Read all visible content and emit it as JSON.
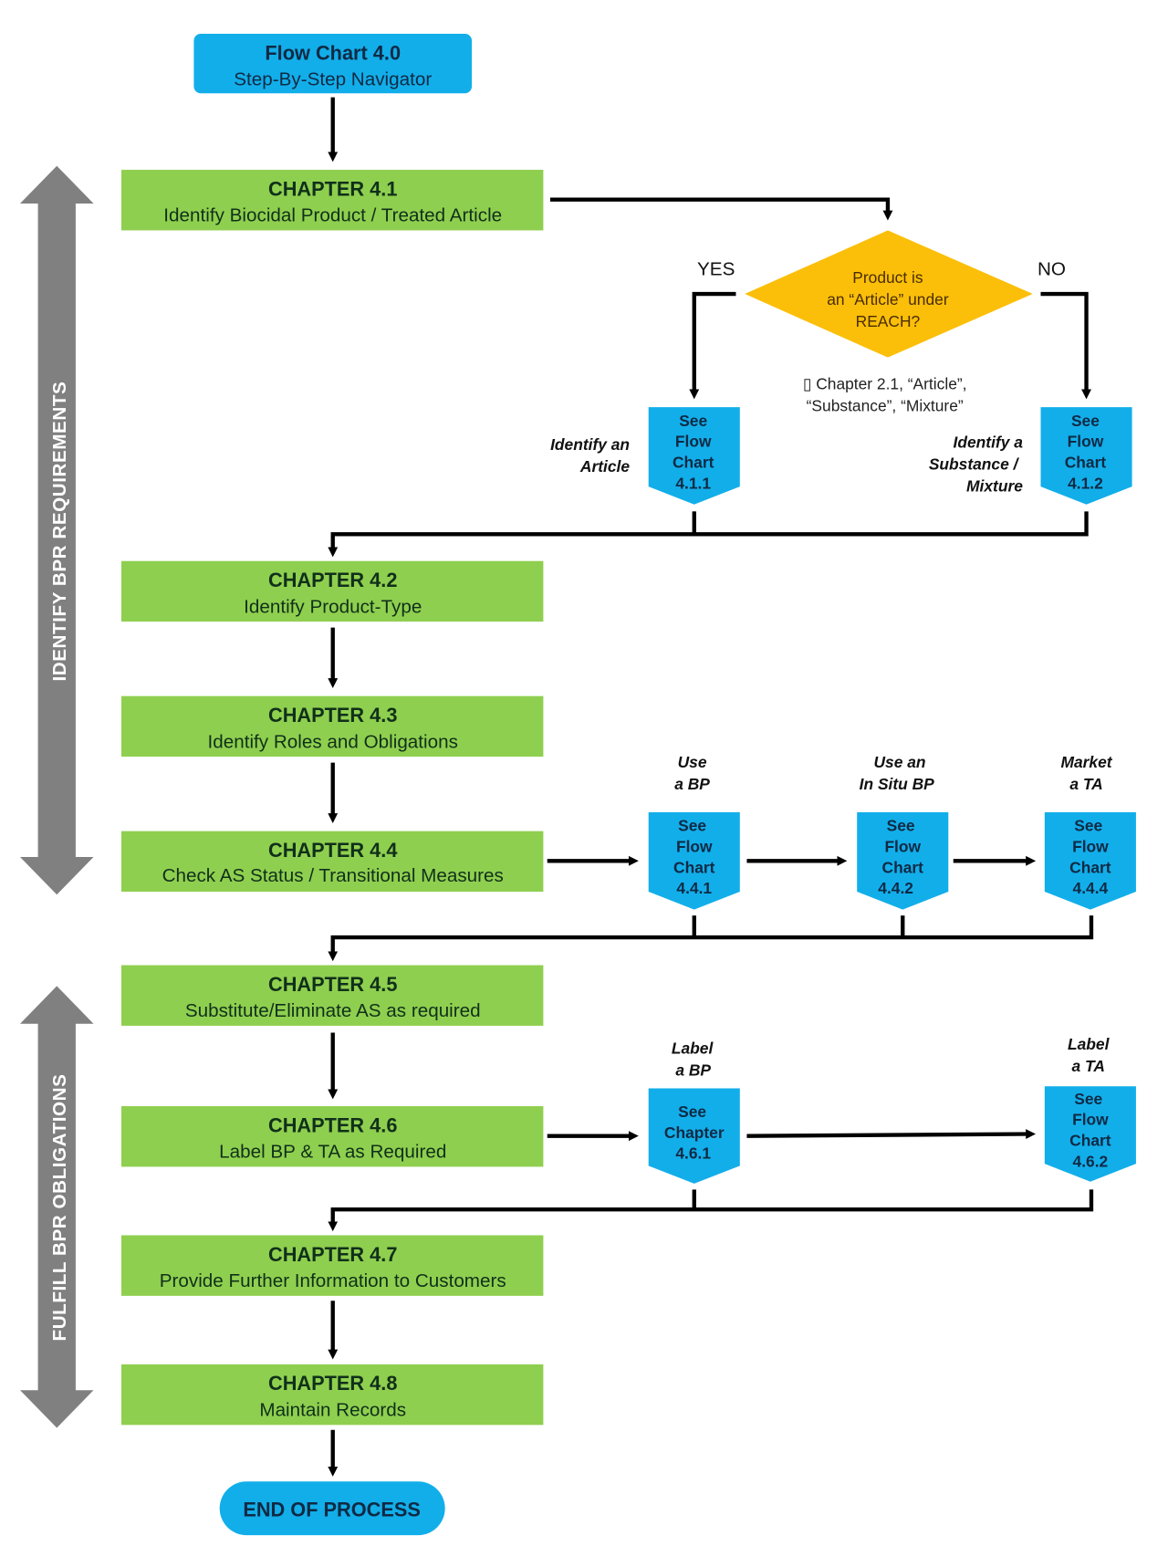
{
  "colors": {
    "start_box": "#12aeea",
    "chapter_box": "#8fcf4f",
    "connector": "#12aeea",
    "decision": "#fbbf0a",
    "side_arrow": "#808080",
    "line": "#000000"
  },
  "start": {
    "title": "Flow Chart 4.0",
    "subtitle": "Step-By-Step Navigator"
  },
  "side_labels": {
    "top": "IDENTIFY BPR REQUIREMENTS",
    "bottom": "FULFILL BPR OBLIGATIONS"
  },
  "chapters": [
    {
      "title": "CHAPTER 4.1",
      "subtitle": "Identify Biocidal Product / Treated Article"
    },
    {
      "title": "CHAPTER 4.2",
      "subtitle": "Identify Product-Type"
    },
    {
      "title": "CHAPTER 4.3",
      "subtitle": "Identify Roles and Obligations"
    },
    {
      "title": "CHAPTER 4.4",
      "subtitle": "Check AS Status / Transitional Measures"
    },
    {
      "title": "CHAPTER 4.5",
      "subtitle": "Substitute/Eliminate AS as required"
    },
    {
      "title": "CHAPTER 4.6",
      "subtitle": "Label BP & TA as Required"
    },
    {
      "title": "CHAPTER 4.7",
      "subtitle": "Provide Further Information to Customers"
    },
    {
      "title": "CHAPTER 4.8",
      "subtitle": "Maintain Records"
    }
  ],
  "decision": {
    "lines": [
      "Product is",
      "an “Article” under",
      "REACH?"
    ],
    "yes": "YES",
    "no": "NO",
    "reference": [
      "▯ Chapter 2.1, “Article”,",
      "“Substance”, “Mixture”"
    ]
  },
  "connectors": {
    "c411": {
      "lines": [
        "See",
        "Flow",
        "Chart",
        "4.1.1"
      ],
      "note": [
        "Identify an",
        "Article"
      ]
    },
    "c412": {
      "lines": [
        "See",
        "Flow",
        "Chart",
        "4.1.2"
      ],
      "note": [
        "Identify a",
        "Substance /",
        "Mixture"
      ]
    },
    "c441": {
      "lines": [
        "See",
        "Flow",
        "Chart",
        "4.4.1"
      ],
      "note": [
        "Use",
        "a BP"
      ]
    },
    "c442": {
      "lines": [
        "See",
        "Flow",
        "Chart",
        "4.4.2"
      ],
      "note": [
        "Use an",
        "In Situ BP"
      ]
    },
    "c444": {
      "lines": [
        "See",
        "Flow",
        "Chart",
        "4.4.4"
      ],
      "note": [
        "Market",
        "a TA"
      ]
    },
    "c461": {
      "lines": [
        "See",
        "Chapter",
        "4.6.1"
      ],
      "note": [
        "Label",
        "a BP"
      ]
    },
    "c462": {
      "lines": [
        "See",
        "Flow",
        "Chart",
        "4.6.2"
      ],
      "note": [
        "Label",
        "a TA"
      ]
    }
  },
  "end": {
    "label": "END OF PROCESS"
  }
}
